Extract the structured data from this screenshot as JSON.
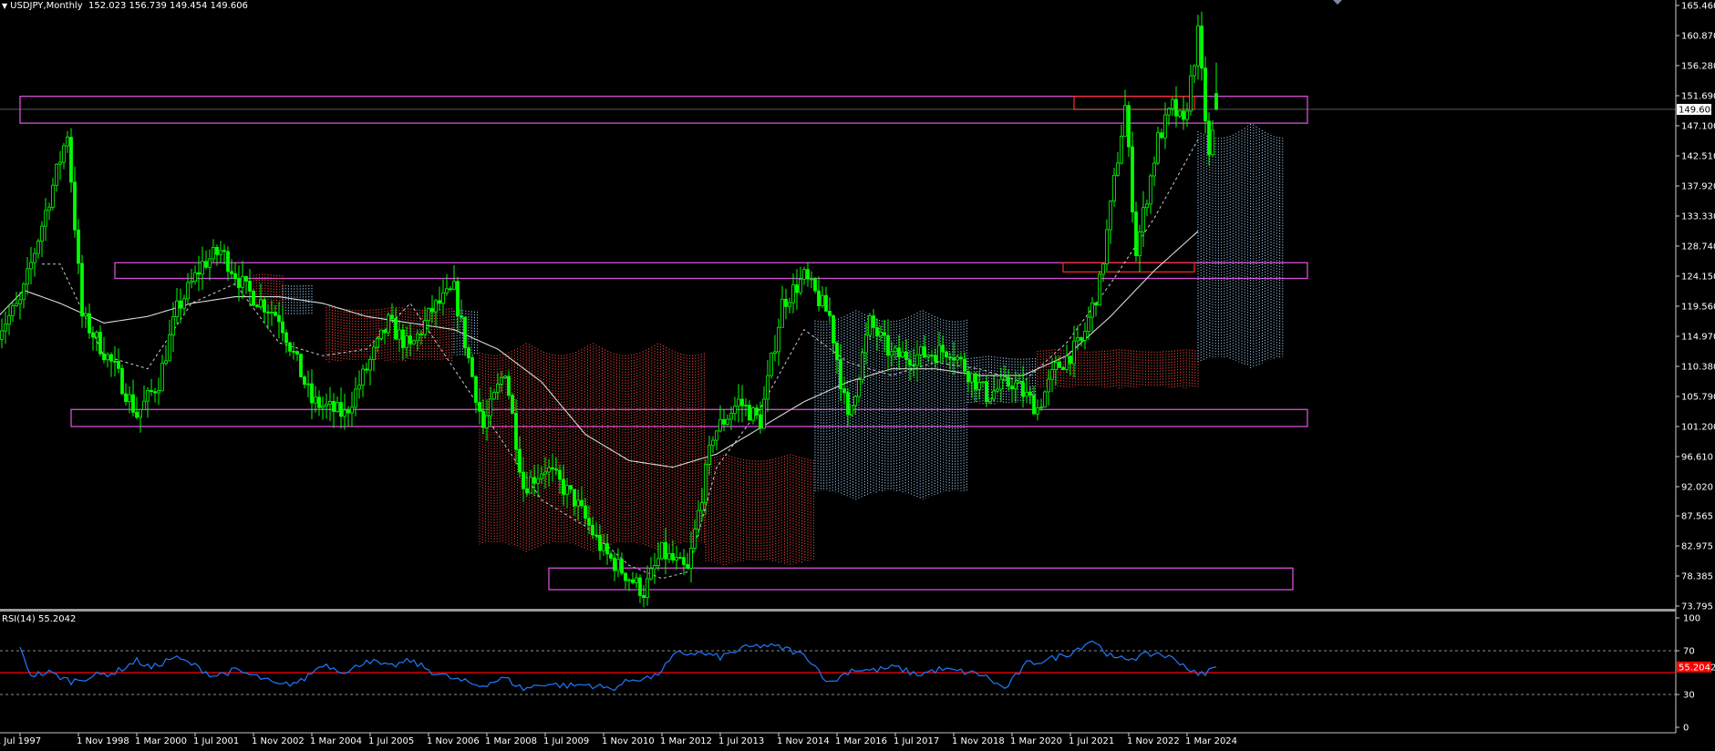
{
  "header": {
    "symbol": "USDJPY,Monthly",
    "ohlc": "152.023 156.739 149.454 149.606"
  },
  "rsi_header": {
    "label": "RSI(14) 55.2042"
  },
  "colors": {
    "background": "#000000",
    "bull_candle": "#00ff00",
    "bear_candle": "#00ff00",
    "ma": "#d8d8d8",
    "kijun": "#cccccc",
    "cloud_bear": "#ff4a3d",
    "cloud_bull": "#9fd3ff",
    "zone_rect": "#d54fd5",
    "red_rect": "#ff2a2a",
    "rsi_line": "#1e7bff",
    "rsi_mid": "#ff0000",
    "axis_text": "#ffffff",
    "separator": "#9a9a9a"
  },
  "chart_data": [
    {
      "type": "candlestick",
      "title": "USDJPY,Monthly",
      "x_tick_labels": [
        "1 Jul 1997",
        "1 Nov 1998",
        "1 Mar 2000",
        "1 Jul 2001",
        "1 Nov 2002",
        "1 Mar 2004",
        "1 Jul 2005",
        "1 Nov 2006",
        "1 Mar 2008",
        "1 Jul 2009",
        "1 Nov 2010",
        "1 Mar 2012",
        "1 Jul 2013",
        "1 Nov 2014",
        "1 Mar 2016",
        "1 Jul 2017",
        "1 Nov 2018",
        "1 Mar 2020",
        "1 Jul 2021",
        "1 Nov 2022",
        "1 Mar 2024"
      ],
      "x_tick_dates": [
        "1997-07",
        "1998-11",
        "2000-03",
        "2001-07",
        "2002-11",
        "2004-03",
        "2005-07",
        "2006-11",
        "2008-03",
        "2009-07",
        "2010-11",
        "2012-03",
        "2013-07",
        "2014-11",
        "2016-03",
        "2017-07",
        "2018-11",
        "2020-03",
        "2021-07",
        "2022-11",
        "2024-03"
      ],
      "y_tick_labels": [
        "165.460",
        "160.870",
        "156.280",
        "151.690",
        "147.100",
        "142.510",
        "137.920",
        "133.330",
        "128.740",
        "124.150",
        "119.560",
        "114.970",
        "110.380",
        "105.790",
        "101.200",
        "96.610",
        "92.020",
        "87.565",
        "82.975",
        "78.385",
        "73.795"
      ],
      "ylim": [
        73.795,
        165.46
      ],
      "current_price": "149.606",
      "last_candle": {
        "open": 152.023,
        "high": 156.739,
        "low": 149.454,
        "close": 149.606
      },
      "price_path_dates": [
        "1997-01",
        "1997-07",
        "1998-08",
        "1998-12",
        "1999-09",
        "2000-03",
        "2000-09",
        "2001-02",
        "2001-09",
        "2002-02",
        "2002-09",
        "2003-06",
        "2004-03",
        "2004-12",
        "2005-12",
        "2006-06",
        "2006-12",
        "2007-06",
        "2008-02",
        "2008-08",
        "2009-01",
        "2009-07",
        "2010-03",
        "2010-11",
        "2011-10",
        "2012-03",
        "2012-10",
        "2013-05",
        "2013-12",
        "2014-06",
        "2014-12",
        "2015-06",
        "2016-01",
        "2016-06",
        "2016-12",
        "2017-06",
        "2018-01",
        "2018-10",
        "2019-08",
        "2020-03",
        "2020-10",
        "2021-03",
        "2021-10",
        "2022-03",
        "2022-10",
        "2023-01",
        "2023-07",
        "2023-11",
        "2024-02",
        "2024-06",
        "2024-09",
        "2024-11"
      ],
      "price_path": [
        116,
        120,
        146,
        118,
        110,
        103,
        108,
        119,
        126,
        128,
        122,
        118,
        105,
        103,
        117,
        113,
        119,
        122,
        101,
        110,
        92,
        95,
        90,
        82,
        76,
        82,
        79,
        100,
        105,
        102,
        120,
        124,
        118,
        102,
        117,
        112,
        112,
        113,
        106,
        108,
        104,
        110,
        114,
        123,
        150,
        128,
        145,
        150,
        147,
        161,
        142,
        149.606
      ],
      "zones": [
        {
          "name": "zone-high",
          "top": 151.6,
          "bottom": 147.5,
          "from": "1997-07",
          "to": "2026-12"
        },
        {
          "name": "zone-mid",
          "top": 126.2,
          "bottom": 123.8,
          "from": "1999-09",
          "to": "2026-12"
        },
        {
          "name": "zone-low",
          "top": 103.8,
          "bottom": 101.2,
          "from": "1998-09",
          "to": "2026-12"
        },
        {
          "name": "zone-bottom",
          "top": 79.6,
          "bottom": 76.3,
          "from": "2009-08",
          "to": "2026-08"
        }
      ],
      "red_rects": [
        {
          "name": "red-rect-top",
          "top": 151.6,
          "bottom": 149.6,
          "from": "2021-08",
          "to": "2024-05"
        },
        {
          "name": "red-rect-mid",
          "top": 126.2,
          "bottom": 124.8,
          "from": "2021-05",
          "to": "2024-05"
        }
      ],
      "ma_path_dates": [
        "1997-01",
        "1997-08",
        "1998-06",
        "1999-06",
        "2000-06",
        "2001-06",
        "2002-06",
        "2003-06",
        "2004-06",
        "2005-06",
        "2006-06",
        "2007-06",
        "2008-06",
        "2009-06",
        "2010-06",
        "2011-06",
        "2012-06",
        "2013-06",
        "2014-06",
        "2015-06",
        "2016-06",
        "2017-06",
        "2018-06",
        "2019-06",
        "2020-06",
        "2021-06",
        "2022-06",
        "2023-06",
        "2024-06"
      ],
      "ma_path": [
        118,
        122,
        120,
        117,
        118,
        120,
        121,
        121,
        120,
        118,
        117,
        116,
        113,
        108,
        100,
        96,
        95,
        97,
        101,
        105,
        108,
        110,
        110,
        109,
        109,
        112,
        118,
        125,
        131
      ],
      "kijun_path_dates": [
        "1998-01",
        "1998-06",
        "1999-06",
        "2000-06",
        "2001-06",
        "2002-06",
        "2003-06",
        "2004-06",
        "2005-06",
        "2006-06",
        "2007-06",
        "2008-06",
        "2009-06",
        "2010-06",
        "2011-06",
        "2012-03",
        "2012-10",
        "2013-06",
        "2014-06",
        "2015-06",
        "2016-06",
        "2017-06",
        "2018-06",
        "2019-06",
        "2020-06",
        "2021-06",
        "2022-06",
        "2023-06",
        "2024-06"
      ],
      "kijun_path": [
        126,
        126,
        112,
        110,
        120,
        123,
        114,
        112,
        113,
        120,
        110,
        100,
        90,
        86,
        80,
        78,
        79,
        95,
        104,
        116,
        111,
        109,
        111,
        110,
        108,
        114,
        123,
        133,
        145
      ],
      "cloud_bands": [
        {
          "kind": "bear",
          "from": "2002-11",
          "to": "2003-07",
          "top": 124.5,
          "bottom": 119.0
        },
        {
          "kind": "bull",
          "from": "2003-07",
          "to": "2004-03",
          "top": 123.0,
          "bottom": 118.0
        },
        {
          "kind": "bear",
          "from": "2004-07",
          "to": "2007-06",
          "top": 119.5,
          "bottom": 111.0
        },
        {
          "kind": "bull",
          "from": "2007-06",
          "to": "2008-01",
          "top": 119.0,
          "bottom": 112.0
        },
        {
          "kind": "bear",
          "from": "2008-01",
          "to": "2013-03",
          "top": 114.0,
          "bottom": 82.0
        },
        {
          "kind": "bear",
          "from": "2013-03",
          "to": "2015-09",
          "top": 97.0,
          "bottom": 80.0
        },
        {
          "kind": "bull",
          "from": "2015-09",
          "to": "2019-03",
          "top": 119.0,
          "bottom": 90.0
        },
        {
          "kind": "bull",
          "from": "2019-03",
          "to": "2020-10",
          "top": 112.0,
          "bottom": 104.5
        },
        {
          "kind": "bear",
          "from": "2020-10",
          "to": "2024-06",
          "top": 113.0,
          "bottom": 107.0
        },
        {
          "kind": "bull",
          "from": "2024-06",
          "to": "2026-06",
          "top": 147.5,
          "bottom": 110.0
        }
      ]
    },
    {
      "type": "line",
      "title": "RSI(14) 55.2042",
      "y_tick_labels": [
        "100",
        "70",
        "30",
        "0"
      ],
      "ylim": [
        0,
        100
      ],
      "levels": [
        70,
        50,
        30
      ],
      "current_value": "55.2042",
      "x_dates": [
        "1997-07",
        "1997-10",
        "1998-03",
        "1998-09",
        "1999-03",
        "1999-09",
        "2000-03",
        "2000-07",
        "2001-01",
        "2001-06",
        "2001-12",
        "2002-06",
        "2003-01",
        "2003-06",
        "2003-12",
        "2004-06",
        "2005-01",
        "2005-06",
        "2005-12",
        "2006-06",
        "2006-12",
        "2007-06",
        "2008-01",
        "2008-08",
        "2009-01",
        "2009-07",
        "2010-01",
        "2010-07",
        "2011-01",
        "2011-07",
        "2012-01",
        "2012-07",
        "2013-01",
        "2013-07",
        "2014-01",
        "2014-07",
        "2015-01",
        "2015-07",
        "2016-01",
        "2016-07",
        "2017-01",
        "2017-07",
        "2018-01",
        "2018-07",
        "2019-01",
        "2019-07",
        "2020-01",
        "2020-07",
        "2021-01",
        "2021-07",
        "2022-01",
        "2022-07",
        "2023-01",
        "2023-07",
        "2024-01",
        "2024-06",
        "2024-11"
      ],
      "values": [
        71,
        48,
        50,
        42,
        47,
        50,
        61,
        54,
        64,
        58,
        47,
        52,
        45,
        38,
        42,
        58,
        50,
        62,
        55,
        61,
        51,
        44,
        38,
        45,
        35,
        40,
        38,
        39,
        35,
        44,
        46,
        67,
        68,
        64,
        72,
        75,
        72,
        64,
        40,
        53,
        52,
        55,
        48,
        53,
        51,
        48,
        35,
        58,
        62,
        68,
        80,
        62,
        64,
        68,
        60,
        47,
        55.2042
      ]
    }
  ]
}
